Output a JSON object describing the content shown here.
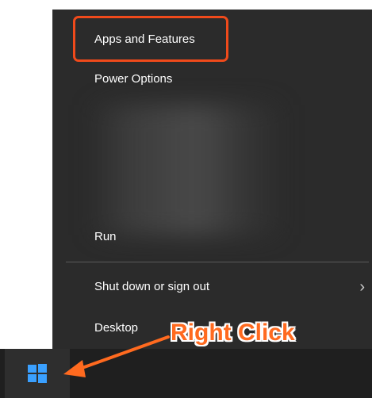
{
  "context_menu": {
    "items": [
      {
        "label": "Apps and Features"
      },
      {
        "label": "Power Options"
      },
      {
        "label": "Run"
      },
      {
        "label": "Shut down or sign out",
        "has_submenu": true
      },
      {
        "label": "Desktop"
      }
    ],
    "submenu_glyph": "›"
  },
  "annotation": {
    "callout_text": "Right Click",
    "highlight_color": "#f04a1b",
    "callout_color": "#ff6a1f"
  },
  "taskbar": {
    "start_icon": "windows-logo-icon",
    "start_icon_color": "#3aa0ff"
  }
}
